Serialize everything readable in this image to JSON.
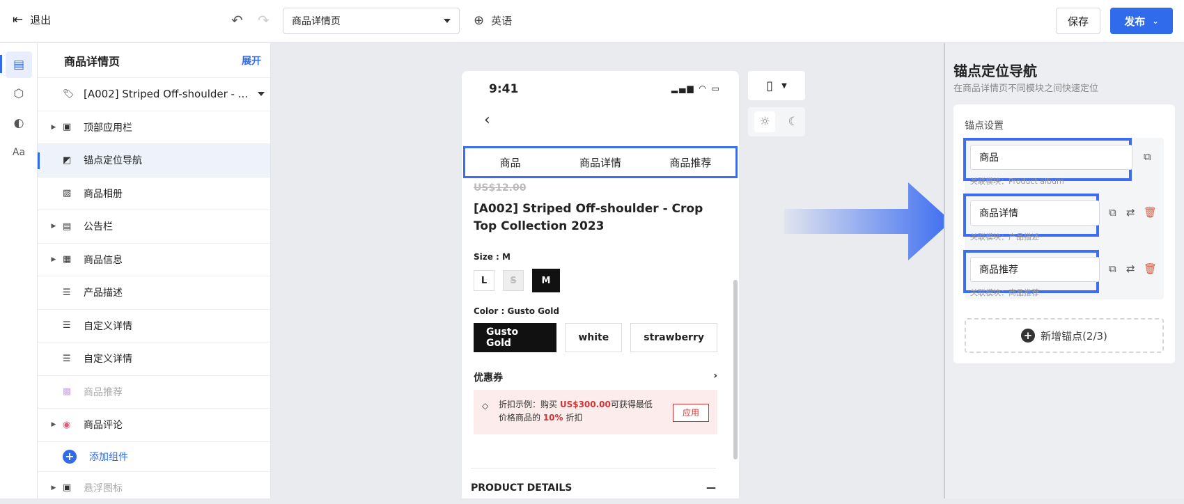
{
  "topbar": {
    "exit_label": "退出",
    "page_select": "商品详情页",
    "language": "英语",
    "save_label": "保存",
    "publish_label": "发布"
  },
  "tree": {
    "title": "商品详情页",
    "expand_label": "展开",
    "items": [
      {
        "label": "[A002] Striped Off-shoulder - ..."
      },
      {
        "label": "顶部应用栏"
      },
      {
        "label": "锚点定位导航"
      },
      {
        "label": "商品相册"
      },
      {
        "label": "公告栏"
      },
      {
        "label": "商品信息"
      },
      {
        "label": "产品描述"
      },
      {
        "label": "自定义详情"
      },
      {
        "label": "自定义详情"
      },
      {
        "label": "商品推荐"
      },
      {
        "label": "商品评论"
      },
      {
        "label": "添加组件"
      },
      {
        "label": "悬浮图标"
      }
    ]
  },
  "phone": {
    "time": "9:41",
    "tabs": [
      "商品",
      "商品详情",
      "商品推荐"
    ],
    "old_price": "US$12.00",
    "title": "[A002] Striped Off-shoulder - Crop Top Collection 2023",
    "size_label": "Size : M",
    "sizes": [
      "L",
      "S",
      "M"
    ],
    "color_label": "Color : Gusto Gold",
    "colors": [
      "Gusto Gold",
      "white",
      "strawberry"
    ],
    "coupon_title": "优惠券",
    "coupon_text_1": "折扣示例：购买 ",
    "coupon_amount": "US$300.00",
    "coupon_text_2": "可获得最低",
    "coupon_text_3": "价格商品的 ",
    "coupon_percent": "10%",
    "coupon_text_4": " 折扣",
    "apply_label": "应用",
    "product_details": "PRODUCT DETAILS"
  },
  "panel": {
    "title": "锚点定位导航",
    "desc": "在商品详情页不同模块之间快速定位",
    "settings_title": "锚点设置",
    "anchors": [
      {
        "value": "商品",
        "linked": "关联模块：Product album"
      },
      {
        "value": "商品详情",
        "linked": "关联模块：产品描述"
      },
      {
        "value": "商品推荐",
        "linked": "关联模块：商品推荐"
      }
    ],
    "add_label": "新增锚点(2/3)"
  },
  "colors": {
    "accent": "#2f6bea",
    "highlight": "#3d6df0",
    "danger": "#d03434"
  }
}
